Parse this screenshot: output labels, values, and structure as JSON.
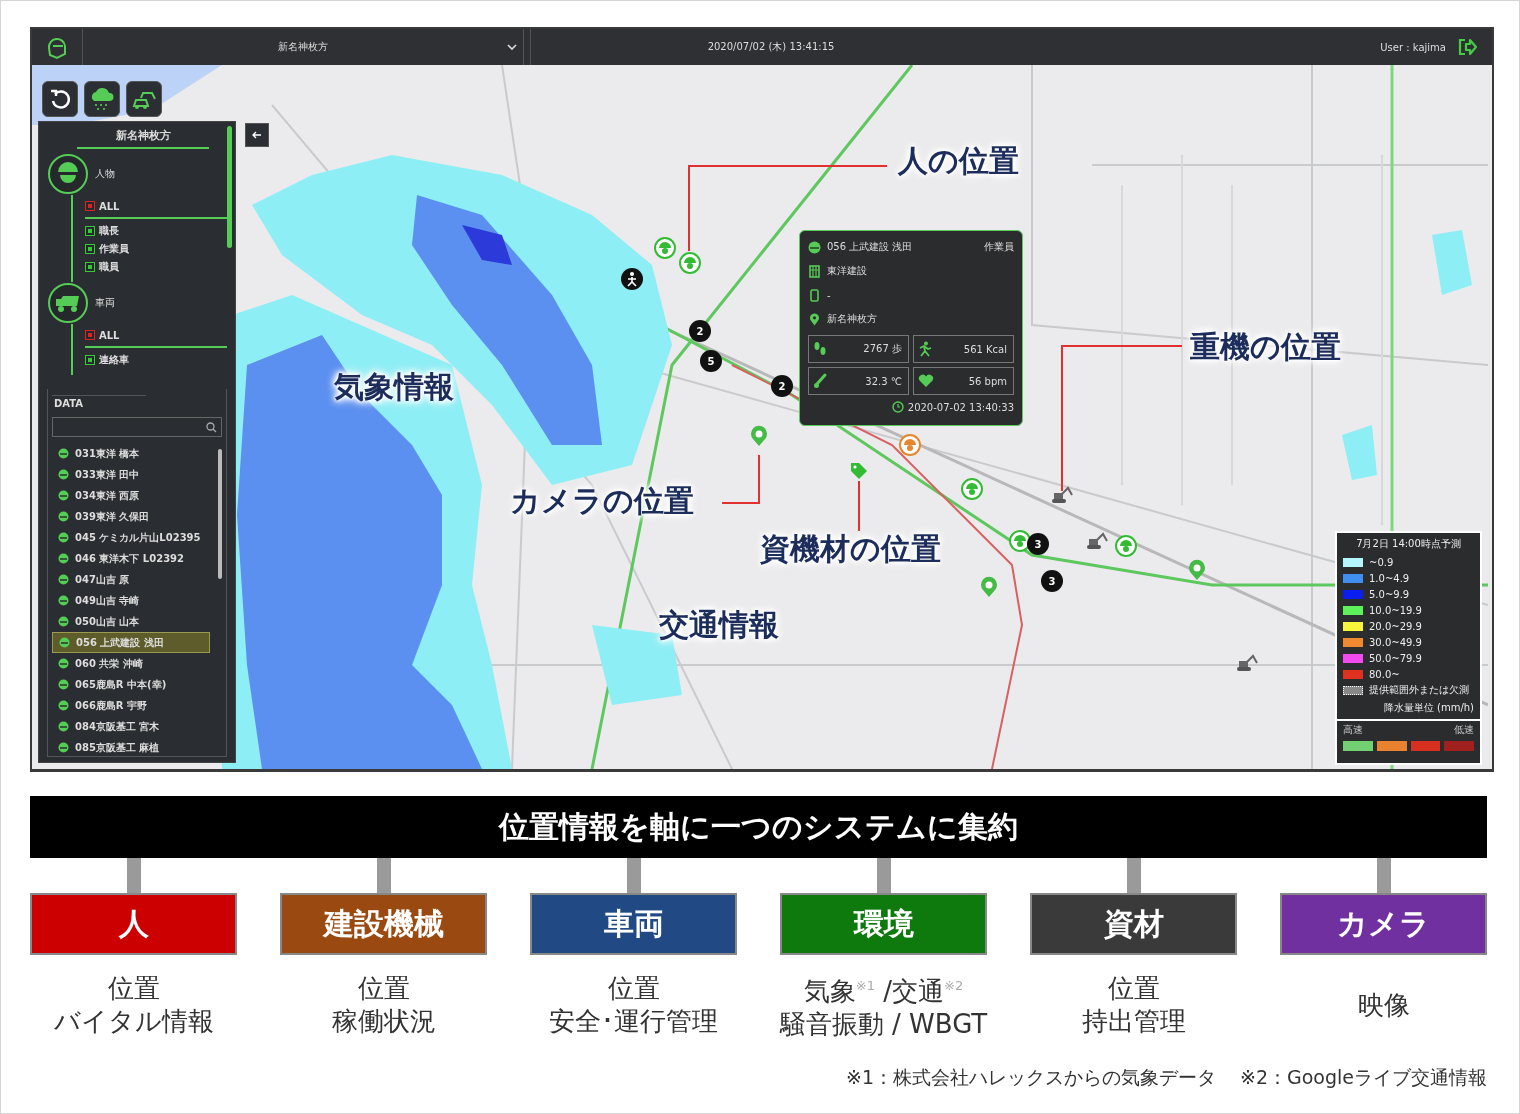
{
  "header": {
    "site": "新名神枚方",
    "datetime": "2020/07/02 (木) 13:41:15",
    "user": "User : kajima"
  },
  "sidebar": {
    "title": "新名神枚方",
    "groups": [
      {
        "kind": "person",
        "label": "人物",
        "filters": [
          {
            "kind": "all",
            "label": "ALL",
            "checked": true
          },
          {
            "kind": "item",
            "label": "職長",
            "checked": true
          },
          {
            "kind": "item",
            "label": "作業員",
            "checked": true
          },
          {
            "kind": "item",
            "label": "職員",
            "checked": true
          }
        ]
      },
      {
        "kind": "vehicle",
        "label": "車両",
        "filters": [
          {
            "kind": "all",
            "label": "ALL",
            "checked": true
          },
          {
            "kind": "item",
            "label": "連絡車",
            "checked": true
          }
        ]
      }
    ],
    "data_panel": {
      "title": "DATA",
      "items": [
        {
          "label": "031東洋 橋本",
          "selected": false
        },
        {
          "label": "033東洋 田中",
          "selected": false
        },
        {
          "label": "034東洋 西原",
          "selected": false
        },
        {
          "label": "039東洋 久保田",
          "selected": false
        },
        {
          "label": "045 ケミカル片山L02395",
          "selected": false
        },
        {
          "label": "046 東洋木下 L02392",
          "selected": false
        },
        {
          "label": "047山吉 原",
          "selected": false
        },
        {
          "label": "049山吉 寺崎",
          "selected": false
        },
        {
          "label": "050山吉 山本",
          "selected": false
        },
        {
          "label": "056 上武建設 浅田",
          "selected": true
        },
        {
          "label": "060 共栄 沖崎",
          "selected": false
        },
        {
          "label": "065鹿島R 中本(幸)",
          "selected": false
        },
        {
          "label": "066鹿島R 宇野",
          "selected": false
        },
        {
          "label": "084京阪基工 宮木",
          "selected": false
        },
        {
          "label": "085京阪基工 麻植",
          "selected": false
        }
      ]
    }
  },
  "popup": {
    "name": "056 上武建設 浅田",
    "role": "作業員",
    "company": "東洋建設",
    "phone": "-",
    "site": "新名神枚方",
    "metrics": [
      {
        "kind": "steps",
        "value": "2767 歩"
      },
      {
        "kind": "calories",
        "value": "561 Kcal"
      },
      {
        "kind": "temperature",
        "value": "32.3 ℃"
      },
      {
        "kind": "heart_rate",
        "value": "56 bpm"
      }
    ],
    "updated": "2020-07-02 13:40:33"
  },
  "callouts": [
    {
      "text": "人の位置"
    },
    {
      "text": "重機の位置"
    },
    {
      "text": "気象情報"
    },
    {
      "text": "カメラの位置"
    },
    {
      "text": "資機材の位置"
    },
    {
      "text": "交通情報"
    }
  ],
  "markers": [
    {
      "label": "2"
    },
    {
      "label": "5"
    },
    {
      "label": "2"
    },
    {
      "label": "3"
    },
    {
      "label": "3"
    }
  ],
  "rain_legend": {
    "title": "7月2日 14:00時点予測",
    "items": [
      {
        "label": "~0.9",
        "color": "#b4f6fb"
      },
      {
        "label": "1.0~4.9",
        "color": "#3f8ef0"
      },
      {
        "label": "5.0~9.9",
        "color": "#0a1ef0"
      },
      {
        "label": "10.0~19.9",
        "color": "#5ef25a"
      },
      {
        "label": "20.0~29.9",
        "color": "#f8f53a"
      },
      {
        "label": "30.0~49.9",
        "color": "#f08a30"
      },
      {
        "label": "50.0~79.9",
        "color": "#f04af0"
      },
      {
        "label": "80.0~",
        "color": "#e03020"
      }
    ],
    "no_data": "提供範囲外または欠測",
    "unit": "降水量単位 (mm/h)"
  },
  "traffic_legend": {
    "fast": "高速",
    "slow": "低速",
    "swatches": [
      {
        "color": "#72d072"
      },
      {
        "color": "#e8822e"
      },
      {
        "color": "#d83020"
      },
      {
        "color": "#a02020"
      }
    ]
  },
  "summary": {
    "banner": "位置情報を軸に一つのシステムに集約",
    "categories": [
      {
        "label": "人",
        "color": "#cc0000",
        "lines": [
          "位置",
          "バイタル情報"
        ]
      },
      {
        "label": "建設機械",
        "color": "#9a4a10",
        "lines": [
          "位置",
          "稼働状況"
        ]
      },
      {
        "label": "車両",
        "color": "#214a85",
        "lines": [
          "位置",
          "安全･運行管理"
        ]
      },
      {
        "label": "環境",
        "color": "#0e7a0e",
        "lines": [
          "気象$^{※1}$ /交通$^{※2}$",
          "騒音振動 / WBGT"
        ]
      },
      {
        "label": "資材",
        "color": "#3a3a3a",
        "lines": [
          "位置",
          "持出管理"
        ]
      },
      {
        "label": "カメラ",
        "color": "#7030a0",
        "lines": [
          "映像"
        ]
      }
    ],
    "footnotes": [
      "※1：株式会社ハレックスからの気象データ",
      "※2：Googleライブ交通情報"
    ]
  }
}
